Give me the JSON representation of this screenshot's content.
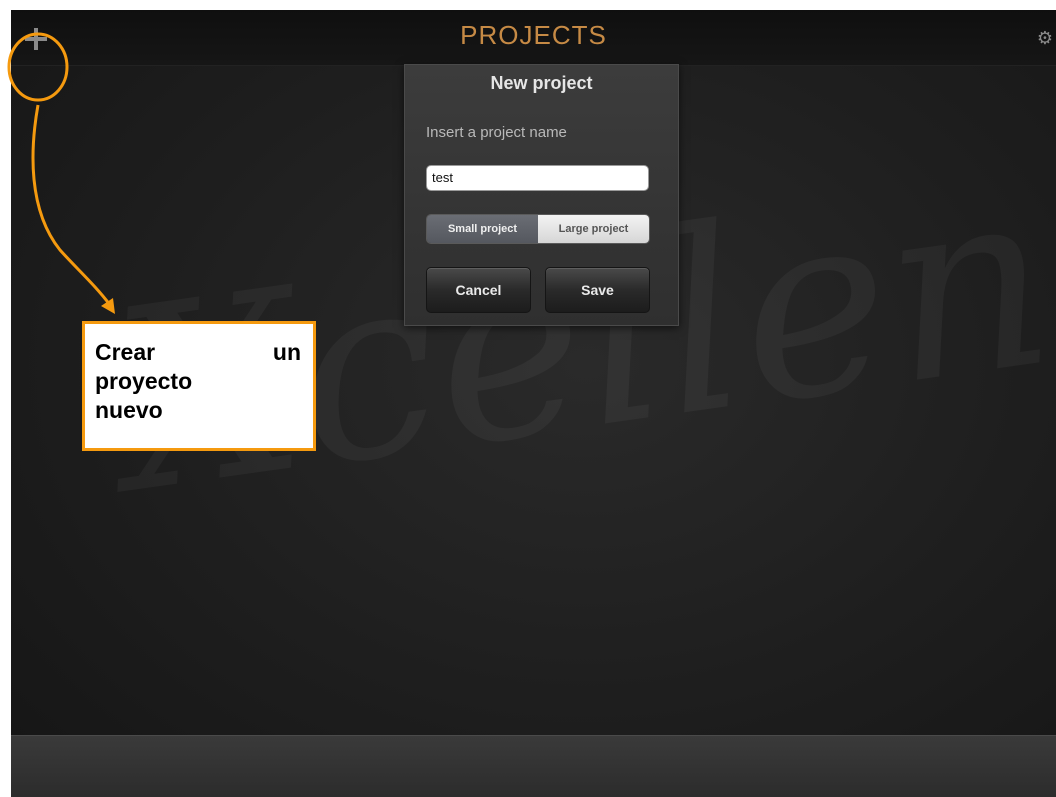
{
  "header": {
    "title": "PROJECTS"
  },
  "icons": {
    "add": "plus-icon",
    "settings": "gear-icon"
  },
  "watermark": {
    "text": "Xcellence"
  },
  "dialog": {
    "title": "New project",
    "prompt": "Insert a project name",
    "input_value": "test",
    "size_options": [
      "Small project",
      "Large project"
    ],
    "selected_size": "Small project",
    "cancel_label": "Cancel",
    "save_label": "Save"
  },
  "annotation": {
    "callout_words": [
      "Crear",
      "un",
      "proyecto",
      "nuevo"
    ],
    "color": "#f59a0f"
  },
  "colors": {
    "title_accent": "#c68a45",
    "annotation": "#f59a0f"
  }
}
